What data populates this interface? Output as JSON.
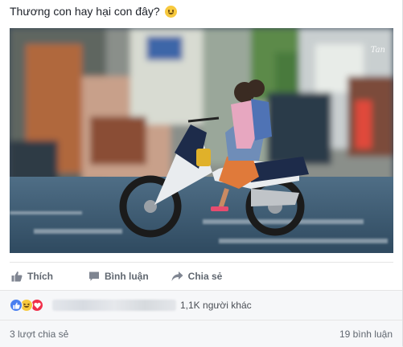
{
  "post": {
    "text": "Thương con hay hại con đây?",
    "emoji": "smiling-face-emoji"
  },
  "photo": {
    "description_icon": "photo",
    "watermark": "Tan"
  },
  "actions": {
    "like_label": "Thích",
    "comment_label": "Bình luận",
    "share_label": "Chia sẻ"
  },
  "reactions": {
    "icons": [
      "like",
      "haha",
      "love"
    ],
    "others_text": "1,1K người khác"
  },
  "footer": {
    "shares_text": "3 lượt chia sẻ",
    "comments_text": "19 bình luận"
  },
  "colors": {
    "like_blue": "#4a7ff0",
    "haha_yellow": "#f7c93e",
    "love_red": "#f0304b",
    "text_gray": "#606770"
  }
}
